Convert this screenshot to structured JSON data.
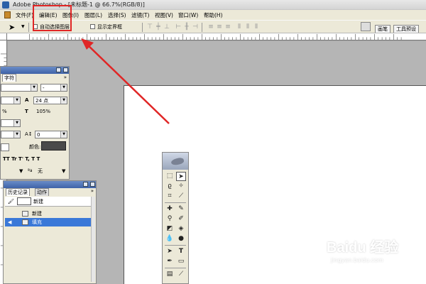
{
  "title_bar": {
    "title": "Adobe Photoshop - [未标题-1 @ 66.7%(RGB/8)]"
  },
  "menu": {
    "items": [
      "文件(F)",
      "编辑(E)",
      "图像(I)",
      "图层(L)",
      "选择(S)",
      "滤镜(T)",
      "视图(V)",
      "窗口(W)",
      "帮助(H)"
    ]
  },
  "options_bar": {
    "auto_select_label": "自动选择图层",
    "show_bounds_label": "显示定界框",
    "palette_tabs": [
      "画笔",
      "工具预设"
    ]
  },
  "character_panel": {
    "tab": "字符",
    "tracking_value": "24 点",
    "vertical_scale": "105%",
    "horizontal_scale": "%",
    "baseline_value": "0",
    "color_label": "颜色:",
    "type_styles": "TT Tr T' T, T T",
    "aa_label": "a",
    "aa_value": "无",
    "dash": "-"
  },
  "history_panel": {
    "tabs": [
      "历史记录",
      "动作"
    ],
    "snapshot_label": "新建",
    "items": [
      {
        "label": "新建",
        "selected": false
      },
      {
        "label": "填充",
        "selected": true
      }
    ]
  },
  "watermark": {
    "main": "Baidu 经验",
    "sub": "jingyan.baidu.com"
  },
  "colors": {
    "highlight": "#e02626",
    "selection": "#3a78d8",
    "char_color_swatch": "#4a4a4a"
  }
}
